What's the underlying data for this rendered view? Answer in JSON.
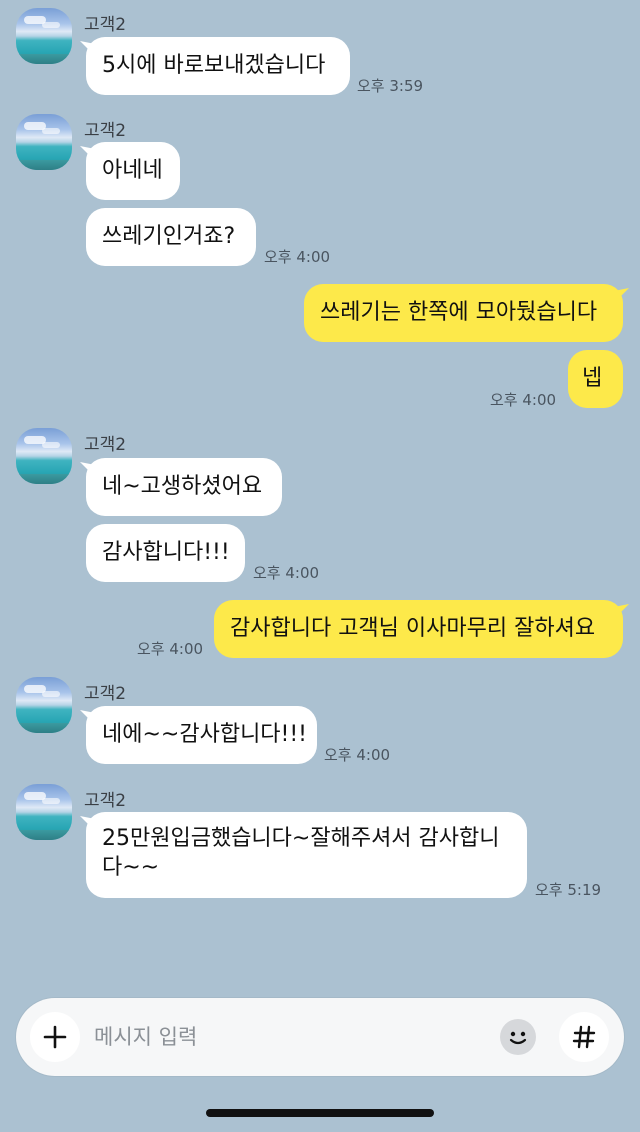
{
  "chat": {
    "messages": [
      {
        "sender": "고객2",
        "text": "5시에 바로보내겠습니다",
        "time": "오후 3:59"
      },
      {
        "sender": "고객2",
        "text1": "아네네",
        "text2": "쓰레기인거죠?",
        "time": "오후 4:00"
      },
      {
        "me_text1": "쓰레기는 한쪽에 모아뒀습니다",
        "me_text2": "넵",
        "time": "오후 4:00"
      },
      {
        "sender": "고객2",
        "text1": "네~고생하셨어요",
        "text2": "감사합니다!!!",
        "time": "오후 4:00"
      },
      {
        "me_text": "감사합니다 고객님 이사마무리 잘하셔요",
        "time": "오후 4:00"
      },
      {
        "sender": "고객2",
        "text": "네에~~감사합니다!!!",
        "time": "오후 4:00"
      },
      {
        "sender": "고객2",
        "text": "25만원입금했습니다~잘해주셔서 감사합니다~~",
        "time": "오후 5:19"
      }
    ]
  },
  "composer": {
    "placeholder": "메시지 입력",
    "plus_icon": "plus-icon",
    "emoji_icon": "emoji-icon",
    "hash_icon": "hash-icon"
  },
  "colors": {
    "background": "#abc1d1",
    "my_bubble": "#fde94a",
    "their_bubble": "#ffffff"
  }
}
